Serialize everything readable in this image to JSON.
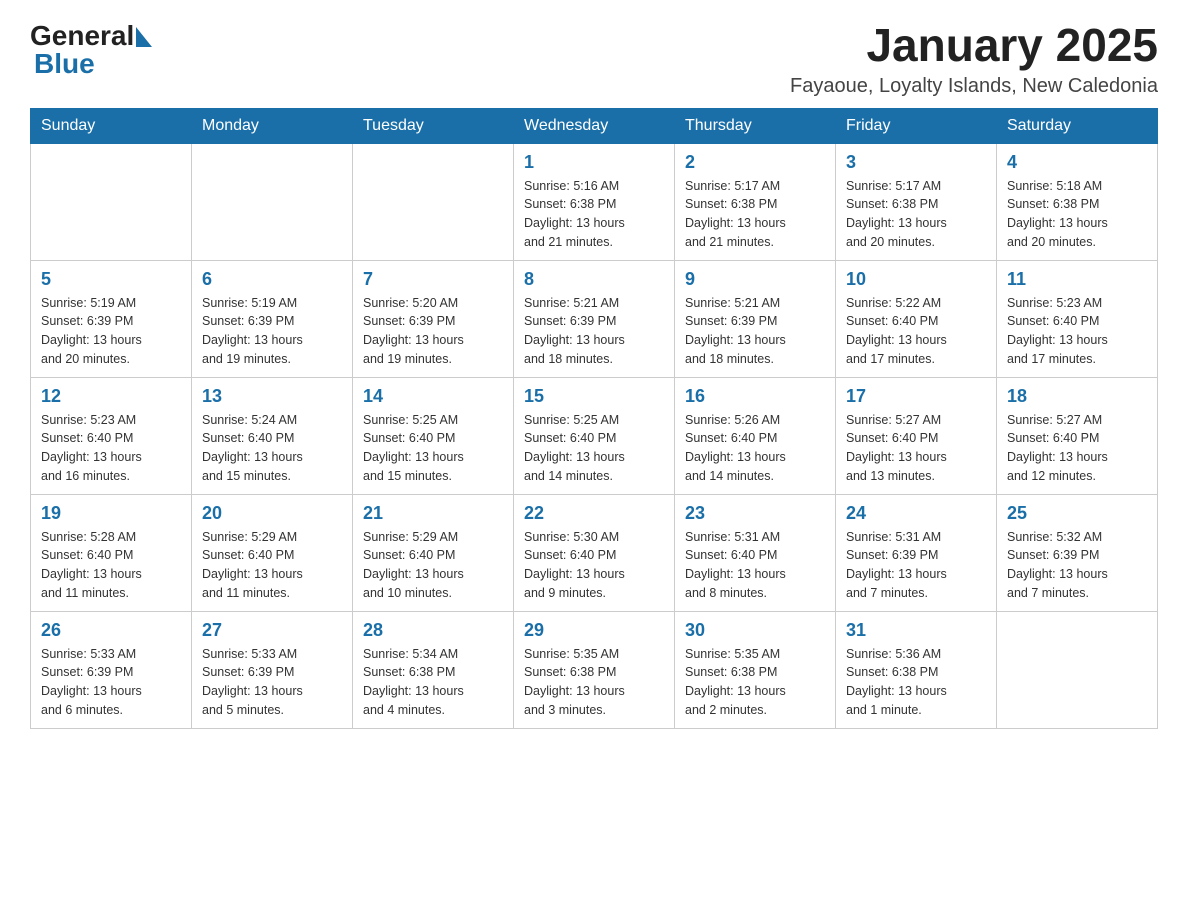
{
  "header": {
    "logo_general": "General",
    "logo_blue": "Blue",
    "month_year": "January 2025",
    "location": "Fayaoue, Loyalty Islands, New Caledonia"
  },
  "days_of_week": [
    "Sunday",
    "Monday",
    "Tuesday",
    "Wednesday",
    "Thursday",
    "Friday",
    "Saturday"
  ],
  "weeks": [
    [
      {
        "num": "",
        "info": ""
      },
      {
        "num": "",
        "info": ""
      },
      {
        "num": "",
        "info": ""
      },
      {
        "num": "1",
        "info": "Sunrise: 5:16 AM\nSunset: 6:38 PM\nDaylight: 13 hours\nand 21 minutes."
      },
      {
        "num": "2",
        "info": "Sunrise: 5:17 AM\nSunset: 6:38 PM\nDaylight: 13 hours\nand 21 minutes."
      },
      {
        "num": "3",
        "info": "Sunrise: 5:17 AM\nSunset: 6:38 PM\nDaylight: 13 hours\nand 20 minutes."
      },
      {
        "num": "4",
        "info": "Sunrise: 5:18 AM\nSunset: 6:38 PM\nDaylight: 13 hours\nand 20 minutes."
      }
    ],
    [
      {
        "num": "5",
        "info": "Sunrise: 5:19 AM\nSunset: 6:39 PM\nDaylight: 13 hours\nand 20 minutes."
      },
      {
        "num": "6",
        "info": "Sunrise: 5:19 AM\nSunset: 6:39 PM\nDaylight: 13 hours\nand 19 minutes."
      },
      {
        "num": "7",
        "info": "Sunrise: 5:20 AM\nSunset: 6:39 PM\nDaylight: 13 hours\nand 19 minutes."
      },
      {
        "num": "8",
        "info": "Sunrise: 5:21 AM\nSunset: 6:39 PM\nDaylight: 13 hours\nand 18 minutes."
      },
      {
        "num": "9",
        "info": "Sunrise: 5:21 AM\nSunset: 6:39 PM\nDaylight: 13 hours\nand 18 minutes."
      },
      {
        "num": "10",
        "info": "Sunrise: 5:22 AM\nSunset: 6:40 PM\nDaylight: 13 hours\nand 17 minutes."
      },
      {
        "num": "11",
        "info": "Sunrise: 5:23 AM\nSunset: 6:40 PM\nDaylight: 13 hours\nand 17 minutes."
      }
    ],
    [
      {
        "num": "12",
        "info": "Sunrise: 5:23 AM\nSunset: 6:40 PM\nDaylight: 13 hours\nand 16 minutes."
      },
      {
        "num": "13",
        "info": "Sunrise: 5:24 AM\nSunset: 6:40 PM\nDaylight: 13 hours\nand 15 minutes."
      },
      {
        "num": "14",
        "info": "Sunrise: 5:25 AM\nSunset: 6:40 PM\nDaylight: 13 hours\nand 15 minutes."
      },
      {
        "num": "15",
        "info": "Sunrise: 5:25 AM\nSunset: 6:40 PM\nDaylight: 13 hours\nand 14 minutes."
      },
      {
        "num": "16",
        "info": "Sunrise: 5:26 AM\nSunset: 6:40 PM\nDaylight: 13 hours\nand 14 minutes."
      },
      {
        "num": "17",
        "info": "Sunrise: 5:27 AM\nSunset: 6:40 PM\nDaylight: 13 hours\nand 13 minutes."
      },
      {
        "num": "18",
        "info": "Sunrise: 5:27 AM\nSunset: 6:40 PM\nDaylight: 13 hours\nand 12 minutes."
      }
    ],
    [
      {
        "num": "19",
        "info": "Sunrise: 5:28 AM\nSunset: 6:40 PM\nDaylight: 13 hours\nand 11 minutes."
      },
      {
        "num": "20",
        "info": "Sunrise: 5:29 AM\nSunset: 6:40 PM\nDaylight: 13 hours\nand 11 minutes."
      },
      {
        "num": "21",
        "info": "Sunrise: 5:29 AM\nSunset: 6:40 PM\nDaylight: 13 hours\nand 10 minutes."
      },
      {
        "num": "22",
        "info": "Sunrise: 5:30 AM\nSunset: 6:40 PM\nDaylight: 13 hours\nand 9 minutes."
      },
      {
        "num": "23",
        "info": "Sunrise: 5:31 AM\nSunset: 6:40 PM\nDaylight: 13 hours\nand 8 minutes."
      },
      {
        "num": "24",
        "info": "Sunrise: 5:31 AM\nSunset: 6:39 PM\nDaylight: 13 hours\nand 7 minutes."
      },
      {
        "num": "25",
        "info": "Sunrise: 5:32 AM\nSunset: 6:39 PM\nDaylight: 13 hours\nand 7 minutes."
      }
    ],
    [
      {
        "num": "26",
        "info": "Sunrise: 5:33 AM\nSunset: 6:39 PM\nDaylight: 13 hours\nand 6 minutes."
      },
      {
        "num": "27",
        "info": "Sunrise: 5:33 AM\nSunset: 6:39 PM\nDaylight: 13 hours\nand 5 minutes."
      },
      {
        "num": "28",
        "info": "Sunrise: 5:34 AM\nSunset: 6:38 PM\nDaylight: 13 hours\nand 4 minutes."
      },
      {
        "num": "29",
        "info": "Sunrise: 5:35 AM\nSunset: 6:38 PM\nDaylight: 13 hours\nand 3 minutes."
      },
      {
        "num": "30",
        "info": "Sunrise: 5:35 AM\nSunset: 6:38 PM\nDaylight: 13 hours\nand 2 minutes."
      },
      {
        "num": "31",
        "info": "Sunrise: 5:36 AM\nSunset: 6:38 PM\nDaylight: 13 hours\nand 1 minute."
      },
      {
        "num": "",
        "info": ""
      }
    ]
  ]
}
